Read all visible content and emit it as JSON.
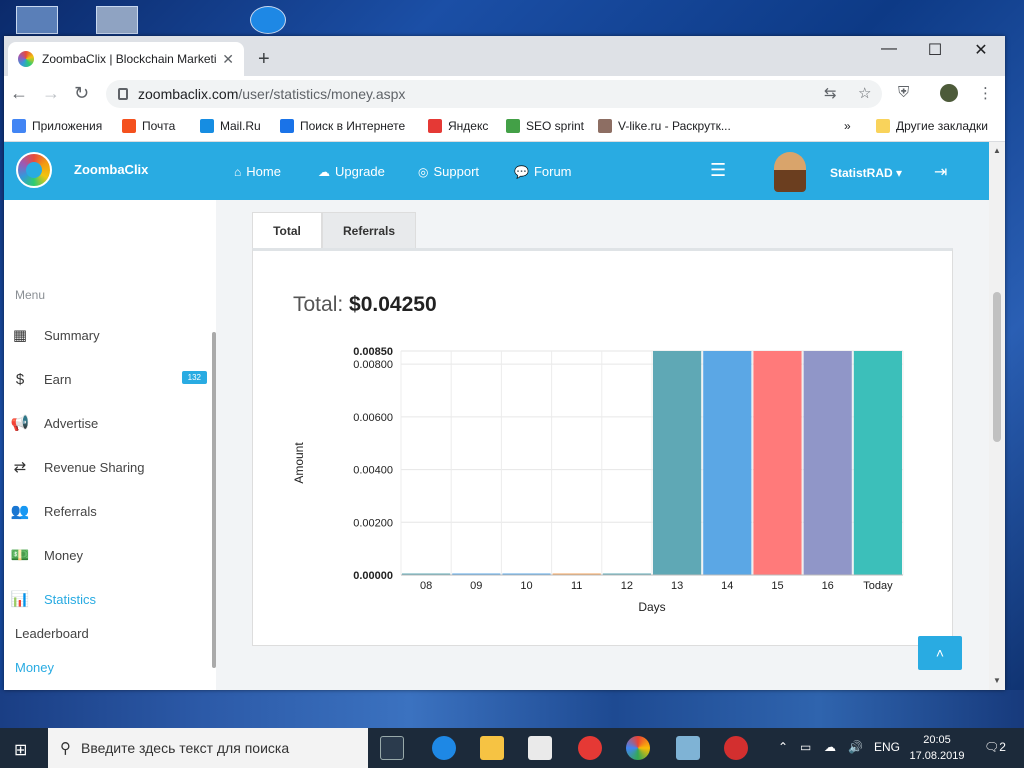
{
  "browser": {
    "tab_title": "ZoombaClix | Blockchain Marketi",
    "tab_close": "✕",
    "new_tab": "+",
    "url_domain": "zoombaclix.com",
    "url_path": "/user/statistics/money.aspx",
    "window_controls": [
      "—",
      "☐",
      "✕"
    ],
    "bookmarks": [
      {
        "label": "Приложения",
        "icon": "apps-grid-icon",
        "color": "#4285f4"
      },
      {
        "label": "Почта",
        "icon": "mail-icon",
        "color": "#f4511e"
      },
      {
        "label": "Mail.Ru",
        "icon": "mailru-icon",
        "color": "#168de2"
      },
      {
        "label": "Поиск в Интернете",
        "icon": "search-icon",
        "color": "#1a73e8"
      },
      {
        "label": "Яндекс",
        "icon": "yandex-icon",
        "color": "#e53935"
      },
      {
        "label": "SEO sprint",
        "icon": "seosprint-icon",
        "color": "#43a047"
      },
      {
        "label": "V-like.ru - Раскрутк...",
        "icon": "vlike-icon",
        "color": "#8d6e63"
      }
    ],
    "more_bookmarks": "»",
    "other_bookmarks": "Другие закладки"
  },
  "site": {
    "brand": "ZoombaClix",
    "nav": [
      {
        "label": "Home",
        "icon": "home-icon",
        "glyph": "⌂"
      },
      {
        "label": "Upgrade",
        "icon": "cloud-upload-icon",
        "glyph": "☁"
      },
      {
        "label": "Support",
        "icon": "lifebuoy-icon",
        "glyph": "◎"
      },
      {
        "label": "Forum",
        "icon": "chat-icon",
        "glyph": "💬"
      }
    ],
    "username": "StatistRAD",
    "accent": "#29abe2"
  },
  "sidebar": {
    "menu_heading": "Menu",
    "items": [
      {
        "label": "Summary",
        "icon": "dashboard-icon",
        "glyph": "▦"
      },
      {
        "label": "Earn",
        "icon": "dollar-icon",
        "glyph": "$",
        "badge": "132"
      },
      {
        "label": "Advertise",
        "icon": "megaphone-icon",
        "glyph": "📢"
      },
      {
        "label": "Revenue Sharing",
        "icon": "exchange-icon",
        "glyph": "⇄"
      },
      {
        "label": "Referrals",
        "icon": "users-icon",
        "glyph": "👥"
      },
      {
        "label": "Money",
        "icon": "money-icon",
        "glyph": "💵"
      },
      {
        "label": "Statistics",
        "icon": "bar-chart-icon",
        "glyph": "📊",
        "active": true
      }
    ],
    "sub_items": [
      {
        "label": "Leaderboard"
      },
      {
        "label": "Money",
        "active": true
      }
    ]
  },
  "main": {
    "tabs": [
      "Total",
      "Referrals"
    ],
    "total_label": "Total: ",
    "total_value": "$0.04250"
  },
  "chart_data": {
    "type": "bar",
    "categories": [
      "08",
      "09",
      "10",
      "11",
      "12",
      "13",
      "14",
      "15",
      "16",
      "Today"
    ],
    "values": [
      0,
      0,
      0,
      0,
      0,
      0.0085,
      0.0085,
      0.0085,
      0.0085,
      0.0085
    ],
    "colors": [
      "#5fa8b5",
      "#5ba7e5",
      "#5ba7e5",
      "#f0a35e",
      "#5fa8b5",
      "#5fa8b5",
      "#5ba7e5",
      "#ff7a7a",
      "#9096c8",
      "#3cbfba"
    ],
    "xlabel": "Days",
    "ylabel": "Amount",
    "y_ticks": [
      "0.00000",
      "0.00200",
      "0.00400",
      "0.00600",
      "0.00800",
      "0.00850"
    ],
    "ylim": [
      0,
      0.0085
    ],
    "grid": true
  },
  "taskbar": {
    "search_placeholder": "Введите здесь текст для поиска",
    "lang": "ENG",
    "time": "20:05",
    "date": "17.08.2019",
    "notifications": "2"
  }
}
